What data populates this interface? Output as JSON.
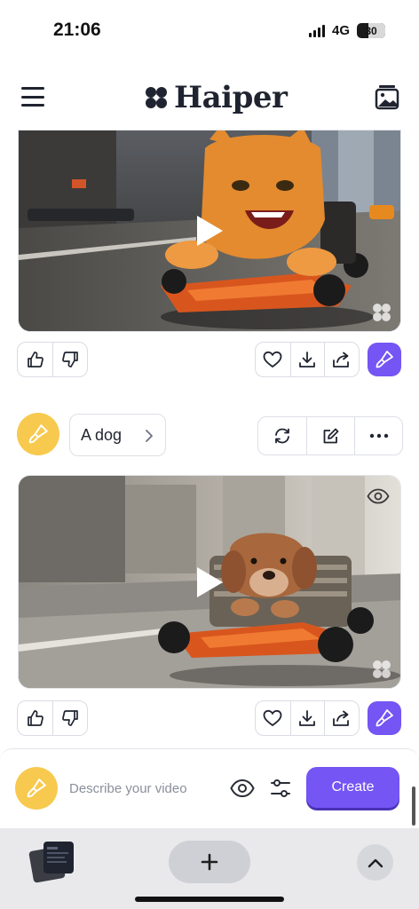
{
  "status_bar": {
    "time": "21:06",
    "network": "4G",
    "battery": "30"
  },
  "header": {
    "brand": "Haiper"
  },
  "videos": [
    {
      "subject": "orange cat driving go-kart"
    },
    {
      "subject": "dog driving go-kart"
    }
  ],
  "prompt": {
    "text": "A dog"
  },
  "composer": {
    "placeholder": "Describe your video",
    "create_label": "Create"
  },
  "colors": {
    "accent": "#7555f3",
    "avatar": "#f7c94e",
    "text": "#1f2430"
  },
  "icons": [
    "menu-icon",
    "haiper-logo-icon",
    "gallery-icon",
    "play-icon",
    "eye-icon",
    "thumbs-up-icon",
    "thumbs-down-icon",
    "heart-icon",
    "download-icon",
    "share-icon",
    "brush-icon",
    "chevron-right-icon",
    "refresh-icon",
    "edit-icon",
    "more-icon",
    "settings-icon",
    "plus-icon",
    "chevron-up-icon"
  ]
}
